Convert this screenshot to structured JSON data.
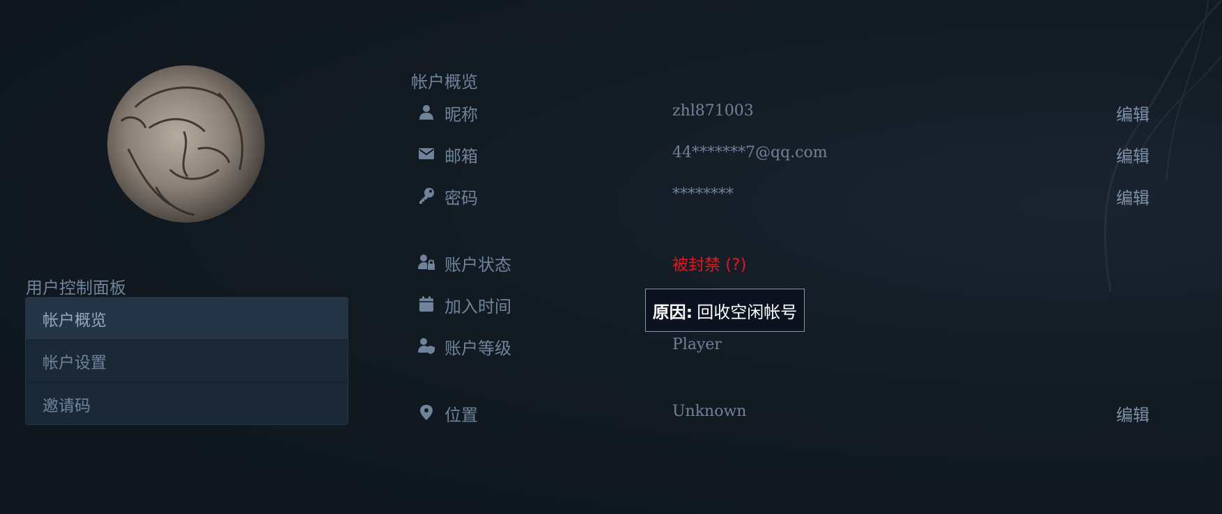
{
  "sidebar": {
    "title": "用户控制面板",
    "items": [
      {
        "label": "帐户概览",
        "active": true
      },
      {
        "label": "帐户设置",
        "active": false
      },
      {
        "label": "邀请码",
        "active": false
      }
    ]
  },
  "main": {
    "section_title": "帐户概览",
    "rows": {
      "nickname": {
        "icon": "user-icon",
        "label": "昵称",
        "value": "zhl871003",
        "edit": "编辑"
      },
      "email": {
        "icon": "envelope-icon",
        "label": "邮箱",
        "value": "44*******7@qq.com",
        "edit": "编辑"
      },
      "password": {
        "icon": "key-icon",
        "label": "密码",
        "value": "********",
        "edit": "编辑"
      },
      "status": {
        "icon": "user-lock-icon",
        "label": "账户状态",
        "value": "被封禁 (?)"
      },
      "joined": {
        "icon": "calendar-icon",
        "label": "加入时间"
      },
      "level": {
        "icon": "user-shield-icon",
        "label": "账户等级",
        "value": "Player"
      },
      "location": {
        "icon": "map-marker-icon",
        "label": "位置",
        "value": "Unknown",
        "edit": "编辑"
      }
    },
    "tooltip": {
      "prefix": "原因:",
      "text": "回收空闲帐号"
    }
  },
  "colors": {
    "background": "#121a22",
    "text": "#6f839b",
    "status_banned": "#e3161e",
    "sidebar_bg": "#1b2836",
    "sidebar_active": "#243546"
  }
}
